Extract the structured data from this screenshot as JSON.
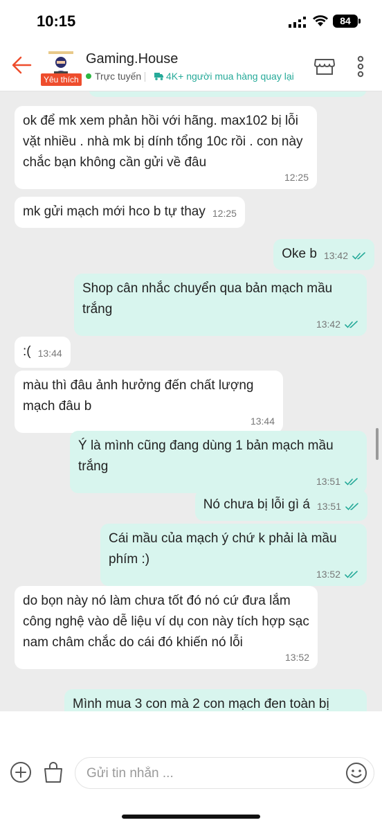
{
  "status_bar": {
    "time": "10:15",
    "battery": "84"
  },
  "header": {
    "shop_name": "Gaming.House",
    "badge": "Yêu thích",
    "online_status": "Trực tuyến",
    "returning_buyers": "4K+ người mua hàng quay lại",
    "accent_color": "#ee4d2d",
    "teal_color": "#26aa99",
    "icons": [
      "back-arrow-icon",
      "shop-icon",
      "more-vertical-icon",
      "truck-icon"
    ]
  },
  "messages": [
    {
      "direction": "in",
      "text": "ok để mk xem phản hồi với hãng. max102 bị lỗi vặt nhiều . nhà mk bị dính tổng 10c rồi . con này chắc bạn không cần gửi về đâu",
      "time": "12:25"
    },
    {
      "direction": "in",
      "text": "mk gửi mạch mới hco b tự thay",
      "time": "12:25"
    },
    {
      "direction": "out",
      "text": "Oke b",
      "time": "13:42",
      "read": true
    },
    {
      "direction": "out",
      "text": "Shop cân nhắc chuyển qua bản mạch mầu trắng",
      "time": "13:42",
      "read": true
    },
    {
      "direction": "in",
      "text": ":(",
      "time": "13:44"
    },
    {
      "direction": "in",
      "text": "màu thì đâu ảnh hưởng đến chất lượng mạch đâu b",
      "time": "13:44"
    },
    {
      "direction": "out",
      "text": "Ý là mình cũng đang dùng 1 bản mạch mầu trắng",
      "time": "13:51",
      "read": true
    },
    {
      "direction": "out",
      "text": "Nó chưa bị lỗi gì á",
      "time": "13:51",
      "read": true
    },
    {
      "direction": "out",
      "text": "Cái mầu của mạch ý chứ k phải là mầu phím :)",
      "time": "13:52",
      "read": true
    },
    {
      "direction": "in",
      "text": "do bọn này nó làm chưa tốt đó nó cứ đưa lắm công nghệ vào dễ liệu ví dụ con này tích hợp sạc nam châm chắc do cái đó khiến nó lỗi",
      "time": "13:52"
    },
    {
      "direction": "out",
      "text": "Mình mua 3 con mà 2 con mạch đen toàn bị",
      "time": "",
      "read": false
    }
  ],
  "composer": {
    "placeholder": "Gửi tin nhắn ...",
    "value": "",
    "icons": [
      "plus-circle-icon",
      "shopping-bag-icon",
      "emoji-icon"
    ]
  }
}
